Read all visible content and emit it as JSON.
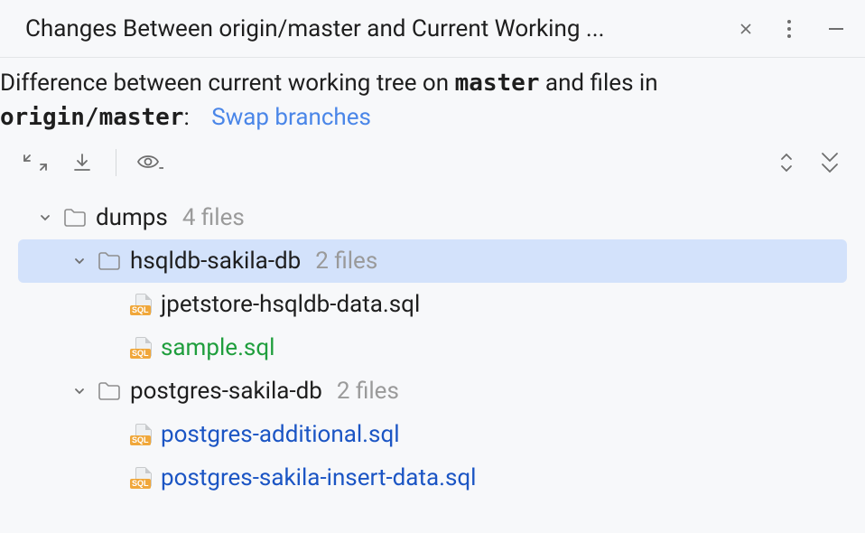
{
  "header": {
    "title": "Changes Between origin/master and Current Working ..."
  },
  "description": {
    "prefix": "Difference between current working tree on ",
    "branch1": "master",
    "mid": " and files in ",
    "branch2": "origin/master",
    "suffix": ":",
    "swap_label": "Swap branches"
  },
  "tree": [
    {
      "type": "folder",
      "name": "dumps",
      "count": "4 files",
      "indent": 1,
      "selected": false
    },
    {
      "type": "folder",
      "name": "hsqldb-sakila-db",
      "count": "2 files",
      "indent": 2,
      "selected": true
    },
    {
      "type": "file",
      "name": "jpetstore-hsqldb-data.sql",
      "status": "default",
      "indent": 3
    },
    {
      "type": "file",
      "name": "sample.sql",
      "status": "added",
      "indent": 3
    },
    {
      "type": "folder",
      "name": "postgres-sakila-db",
      "count": "2 files",
      "indent": 2,
      "selected": false
    },
    {
      "type": "file",
      "name": "postgres-additional.sql",
      "status": "modified",
      "indent": 3
    },
    {
      "type": "file",
      "name": "postgres-sakila-insert-data.sql",
      "status": "modified",
      "indent": 3
    }
  ]
}
